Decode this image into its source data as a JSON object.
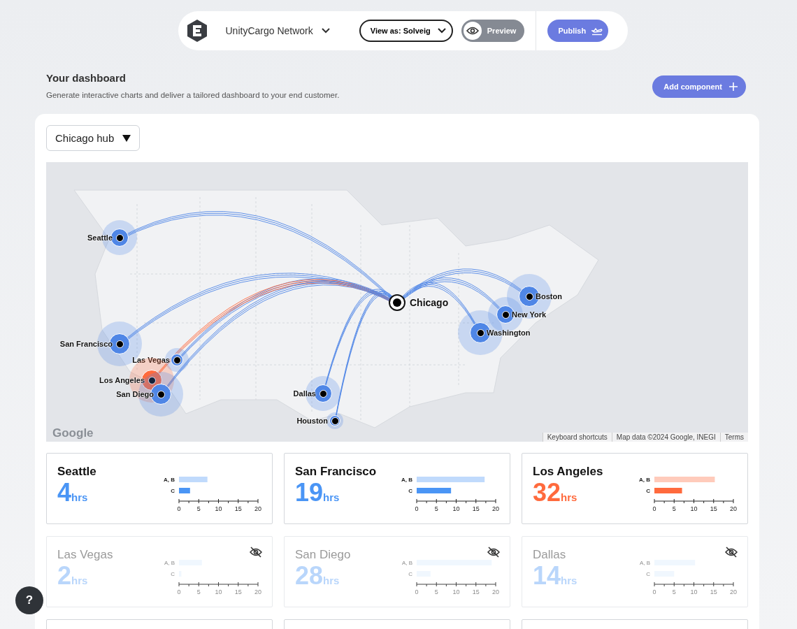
{
  "topbar": {
    "workspace": "UnityCargo Network",
    "view_as": "View as: Solveig",
    "preview": "Preview",
    "publish": "Publish"
  },
  "header": {
    "title": "Your dashboard",
    "subtitle": "Generate interactive charts and deliver a tailored dashboard to your end customer.",
    "add_button": "Add component"
  },
  "hub_select": "Chicago hub",
  "map": {
    "pins": [
      {
        "name": "Seattle",
        "kind": "medium",
        "color": "#4f86e6"
      },
      {
        "name": "San Francisco",
        "kind": "large",
        "color": "#4f86e6"
      },
      {
        "name": "Las Vegas",
        "kind": "small",
        "color": "#4f86e6"
      },
      {
        "name": "Los Angeles",
        "kind": "large",
        "color": "#ff6a3d"
      },
      {
        "name": "San Diego",
        "kind": "large",
        "color": "#4f86e6"
      },
      {
        "name": "Dallas",
        "kind": "medium",
        "color": "#4f86e6"
      },
      {
        "name": "Houston",
        "kind": "tiny",
        "color": "#4f86e6"
      },
      {
        "name": "Chicago",
        "kind": "hub",
        "color": "#111111"
      },
      {
        "name": "Boston",
        "kind": "large",
        "color": "#4f86e6"
      },
      {
        "name": "New York",
        "kind": "medium",
        "color": "#4f86e6"
      },
      {
        "name": "Washington",
        "kind": "large",
        "color": "#4f86e6"
      }
    ],
    "logo": "Google",
    "footer": [
      "Keyboard shortcuts",
      "Map data ©2024 Google, INEGI",
      "Terms"
    ]
  },
  "cards": [
    {
      "city": "Seattle",
      "value": "4",
      "unit": "hrs",
      "hidden": false,
      "color": "#4a95f5",
      "chart_data": {
        "type": "bar",
        "orientation": "horizontal",
        "categories": [
          "A, B",
          "C"
        ],
        "values": [
          7.2,
          2.8
        ],
        "xlim": [
          0,
          20
        ],
        "xticks": [
          0,
          5,
          10,
          15,
          20
        ]
      }
    },
    {
      "city": "San Francisco",
      "value": "19",
      "unit": "hrs",
      "hidden": false,
      "color": "#4a95f5",
      "chart_data": {
        "type": "bar",
        "orientation": "horizontal",
        "categories": [
          "A, B",
          "C"
        ],
        "values": [
          17.2,
          8.7
        ],
        "xlim": [
          0,
          20
        ],
        "xticks": [
          0,
          5,
          10,
          15,
          20
        ]
      }
    },
    {
      "city": "Los Angeles",
      "value": "32",
      "unit": "hrs",
      "hidden": false,
      "color": "#ff6a3d",
      "chart_data": {
        "type": "bar",
        "orientation": "horizontal",
        "categories": [
          "A, B",
          "C"
        ],
        "values": [
          15.3,
          7
        ],
        "xlim": [
          0,
          20
        ],
        "xticks": [
          0,
          5,
          10,
          15,
          20
        ]
      }
    },
    {
      "city": "Las Vegas",
      "value": "2",
      "unit": "hrs",
      "hidden": true,
      "color": "#b9d6fb",
      "chart_data": {
        "type": "bar",
        "orientation": "horizontal",
        "categories": [
          "A, B",
          "C"
        ],
        "values": [
          5.8,
          0.6
        ],
        "xlim": [
          0,
          20
        ],
        "xticks": [
          0,
          5,
          10,
          15,
          20
        ]
      }
    },
    {
      "city": "San Diego",
      "value": "28",
      "unit": "hrs",
      "hidden": true,
      "color": "#b9d6fb",
      "chart_data": {
        "type": "bar",
        "orientation": "horizontal",
        "categories": [
          "A, B",
          "C"
        ],
        "values": [
          19,
          3.5
        ],
        "xlim": [
          0,
          20
        ],
        "xticks": [
          0,
          5,
          10,
          15,
          20
        ]
      }
    },
    {
      "city": "Dallas",
      "value": "14",
      "unit": "hrs",
      "hidden": true,
      "color": "#b9d6fb",
      "chart_data": {
        "type": "bar",
        "orientation": "horizontal",
        "categories": [
          "A, B",
          "C"
        ],
        "values": [
          10.3,
          5
        ],
        "xlim": [
          0,
          20
        ],
        "xticks": [
          0,
          5,
          10,
          15,
          20
        ]
      }
    }
  ],
  "help_button": "?"
}
